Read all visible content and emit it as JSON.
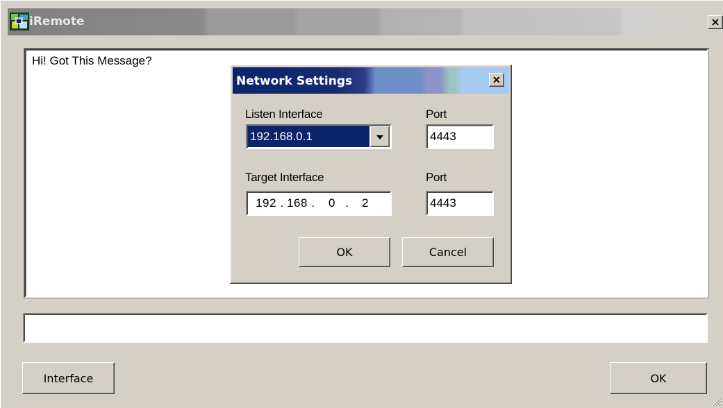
{
  "window": {
    "title": "iRemote",
    "close_label": "×",
    "icon": "app-icon"
  },
  "message_area": {
    "text": "Hi! Got This Message?"
  },
  "input_field": {
    "value": ""
  },
  "buttons": {
    "interface_label": "Interface",
    "ok_label": "OK"
  },
  "dialog": {
    "title": "Network Settings",
    "close_label": "×",
    "listen_interface_label": "Listen Interface",
    "listen_interface_value": "192.168.0.1",
    "listen_port_label": "Port",
    "listen_port_value": "4443",
    "target_interface_label": "Target Interface",
    "target_ip": {
      "octet1": "192",
      "octet2": "168",
      "octet3": "0",
      "octet4": "2",
      "dot": "."
    },
    "target_port_label": "Port",
    "target_port_value": "4443",
    "ok_label": "OK",
    "cancel_label": "Cancel"
  },
  "colors": {
    "window_bg": "#d4d0c8",
    "dialog_title_active": "#0a246a",
    "selection": "#0a246a"
  }
}
